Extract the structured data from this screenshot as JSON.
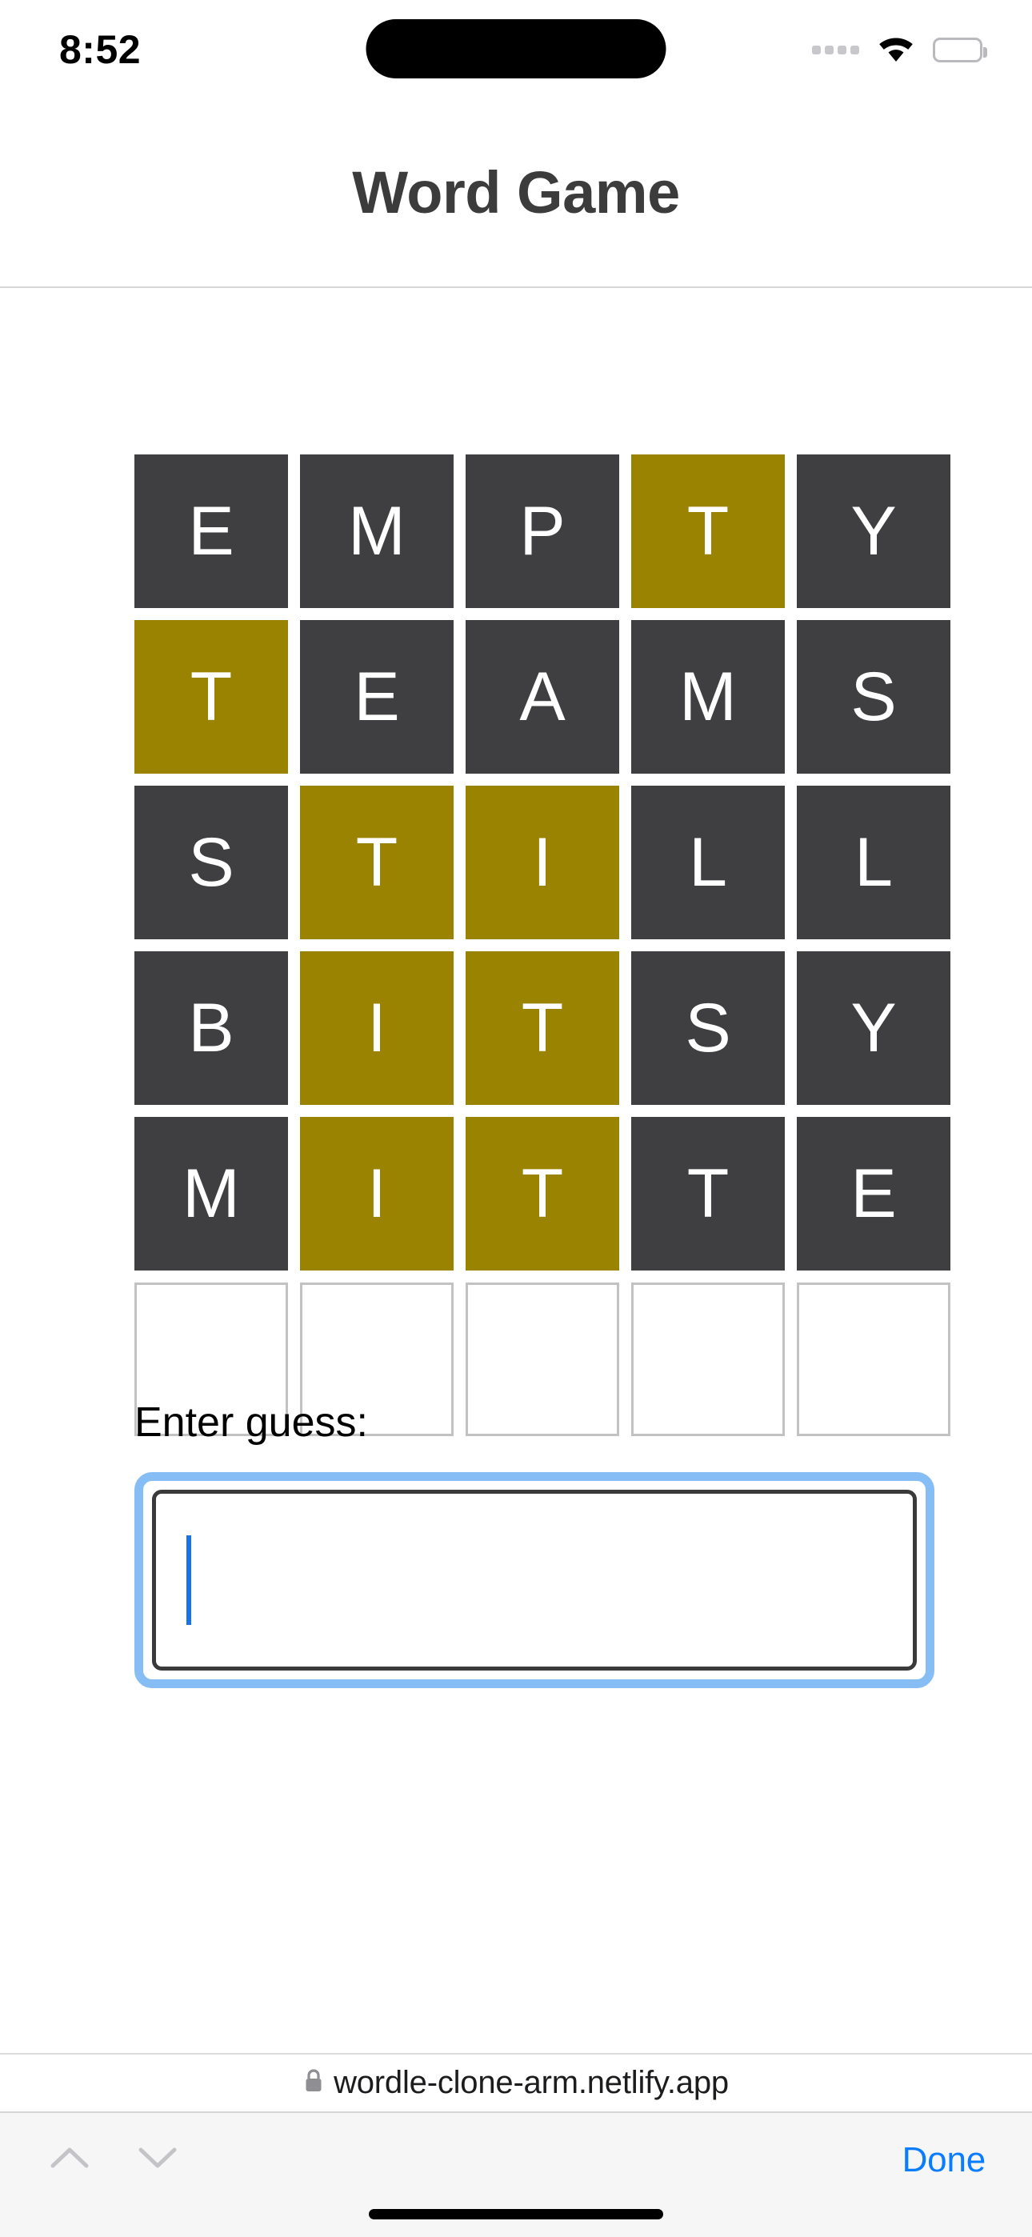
{
  "status_bar": {
    "time": "8:52",
    "cellular_icon": "cellular-dots-icon",
    "wifi_icon": "wifi-icon",
    "battery_icon": "battery-icon"
  },
  "header": {
    "title": "Word Game"
  },
  "game": {
    "rows": [
      {
        "letters": [
          "E",
          "M",
          "P",
          "T",
          "Y"
        ],
        "states": [
          "absent",
          "absent",
          "absent",
          "present",
          "absent"
        ]
      },
      {
        "letters": [
          "T",
          "E",
          "A",
          "M",
          "S"
        ],
        "states": [
          "present",
          "absent",
          "absent",
          "absent",
          "absent"
        ]
      },
      {
        "letters": [
          "S",
          "T",
          "I",
          "L",
          "L"
        ],
        "states": [
          "absent",
          "present",
          "present",
          "absent",
          "absent"
        ]
      },
      {
        "letters": [
          "B",
          "I",
          "T",
          "S",
          "Y"
        ],
        "states": [
          "absent",
          "present",
          "present",
          "absent",
          "absent"
        ]
      },
      {
        "letters": [
          "M",
          "I",
          "T",
          "T",
          "E"
        ],
        "states": [
          "absent",
          "present",
          "present",
          "absent",
          "absent"
        ]
      },
      {
        "letters": [
          "",
          "",
          "",
          "",
          ""
        ],
        "states": [
          "empty",
          "empty",
          "empty",
          "empty",
          "empty"
        ]
      }
    ],
    "colors": {
      "absent": "#3f3f41",
      "present": "#998300",
      "empty_border": "#c2c2c2",
      "letter": "#ffffff"
    }
  },
  "guess_form": {
    "label": "Enter guess:",
    "value": "",
    "placeholder": "",
    "focused": true,
    "focus_ring_color": "#86bdf5",
    "caret_color": "#1a72e8"
  },
  "browser": {
    "url": "wordle-clone-arm.netlify.app",
    "lock_icon": "lock-icon",
    "toolbar": {
      "prev_icon": "chevron-up-icon",
      "next_icon": "chevron-down-icon",
      "done_label": "Done",
      "done_color": "#0a7cff"
    }
  }
}
